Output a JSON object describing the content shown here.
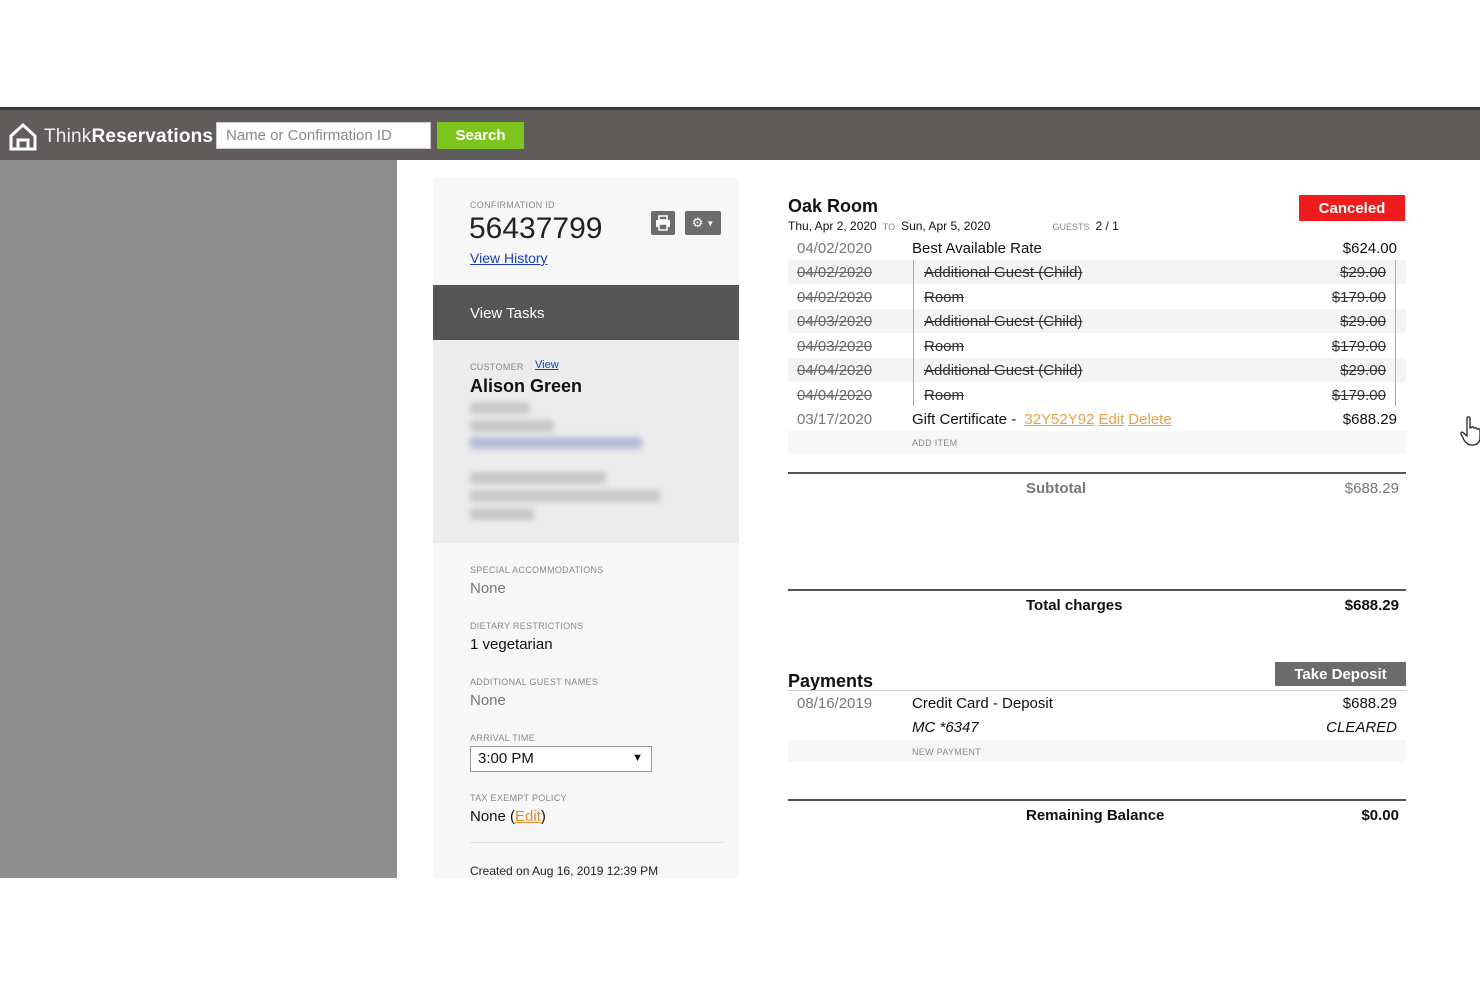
{
  "app": {
    "name_light": "Think",
    "name_bold": "Reservations"
  },
  "search": {
    "placeholder": "Name or Confirmation ID",
    "button": "Search"
  },
  "sidebar": {
    "confirmation_label": "CONFIRMATION ID",
    "confirmation_id": "56437799",
    "view_history": "View History",
    "view_tasks": "View Tasks",
    "customer_label": "CUSTOMER",
    "customer_view": "View",
    "customer_name": "Alison Green",
    "special_label": "SPECIAL ACCOMMODATIONS",
    "special_value": "None",
    "dietary_label": "DIETARY RESTRICTIONS",
    "dietary_value": "1 vegetarian",
    "guest_names_label": "ADDITIONAL GUEST NAMES",
    "guest_names_value": "None",
    "arrival_label": "ARRIVAL TIME",
    "arrival_value": "3:00 PM",
    "tax_label": "TAX EXEMPT POLICY",
    "tax_value_prefix": "None (",
    "tax_edit": "Edit",
    "tax_value_suffix": ")",
    "created": "Created on Aug 16, 2019 12:39 PM"
  },
  "booking": {
    "room": "Oak Room",
    "start": "Thu, Apr 2, 2020",
    "to": "TO",
    "end": "Sun, Apr 5, 2020",
    "guests_label": "GUESTS",
    "guests": "2 / 1",
    "status": "Canceled",
    "status_color": "#ee1c1c",
    "line_items": [
      {
        "date": "04/02/2020",
        "desc": "Best Available Rate",
        "amount": "$624.00"
      },
      {
        "date": "04/02/2020",
        "desc": "Additional Guest (Child)",
        "amount": "$29.00"
      },
      {
        "date": "04/02/2020",
        "desc": "Room",
        "amount": "$179.00"
      },
      {
        "date": "04/03/2020",
        "desc": "Additional Guest (Child)",
        "amount": "$29.00"
      },
      {
        "date": "04/03/2020",
        "desc": "Room",
        "amount": "$179.00"
      },
      {
        "date": "04/04/2020",
        "desc": "Additional Guest (Child)",
        "amount": "$29.00"
      },
      {
        "date": "04/04/2020",
        "desc": "Room",
        "amount": "$179.00"
      }
    ],
    "gift": {
      "date": "03/17/2020",
      "desc": "Gift Certificate - ",
      "code": "32Y52Y92",
      "edit": "Edit",
      "delete": "Delete",
      "amount": "$688.29"
    },
    "add_item": "ADD ITEM",
    "subtotal_label": "Subtotal",
    "subtotal": "$688.29",
    "total_label": "Total charges",
    "total": "$688.29"
  },
  "payments": {
    "title": "Payments",
    "take_deposit": "Take Deposit",
    "date": "08/16/2019",
    "desc": "Credit Card - Deposit",
    "amount": "$688.29",
    "card": "MC *6347",
    "status": "CLEARED",
    "new_payment": "NEW PAYMENT",
    "remaining_label": "Remaining Balance",
    "remaining": "$0.00"
  }
}
